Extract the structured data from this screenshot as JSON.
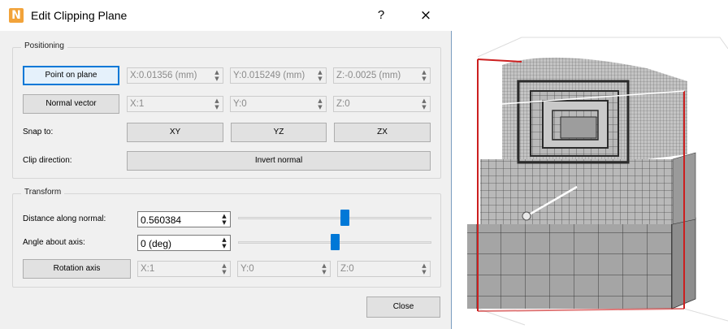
{
  "dialog": {
    "title": "Edit Clipping Plane",
    "help_label": "?",
    "close_icon": "×",
    "app_icon_letter": "N"
  },
  "positioning": {
    "group_title": "Positioning",
    "point_on_plane_label": "Point on plane",
    "point": {
      "x": "X:0.01356 (mm)",
      "y": "Y:0.015249 (mm)",
      "z": "Z:-0.0025 (mm)"
    },
    "normal_vector_label": "Normal vector",
    "normal": {
      "x": "X:1",
      "y": "Y:0",
      "z": "Z:0"
    },
    "snap_to_label": "Snap to:",
    "snap_xy": "XY",
    "snap_yz": "YZ",
    "snap_zx": "ZX",
    "clip_direction_label": "Clip direction:",
    "invert_normal_label": "Invert normal"
  },
  "transform": {
    "group_title": "Transform",
    "distance_label": "Distance along normal:",
    "distance_value": "0.560384",
    "distance_slider_fraction": 0.55,
    "angle_label": "Angle about axis:",
    "angle_value": "0 (deg)",
    "angle_slider_fraction": 0.5,
    "rotation_axis_label": "Rotation axis",
    "axis": {
      "x": "X:1",
      "y": "Y:0",
      "z": "Z:0"
    }
  },
  "footer": {
    "close_label": "Close"
  },
  "colors": {
    "accent": "#0078d7",
    "clip_plane": "#cc1f1f",
    "mesh": "#8c8c8c"
  }
}
